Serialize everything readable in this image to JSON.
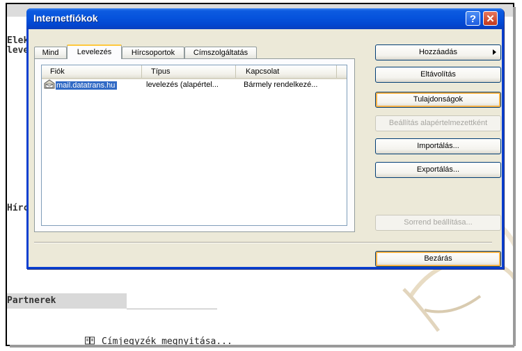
{
  "background": {
    "labels": [
      "Elek",
      "leve",
      "Hírc"
    ],
    "partners_label": "Partnerek",
    "address_book_link": "Címjegyzék megnyitása..."
  },
  "dialog": {
    "title": "Internetfiókok",
    "help_button": "?",
    "close_button": "✕",
    "tabs": [
      "Mind",
      "Levelezés",
      "Hírcsoportok",
      "Címszolgáltatás"
    ],
    "active_tab": "Levelezés",
    "list": {
      "columns": [
        "Fiók",
        "Típus",
        "Kapcsolat"
      ],
      "rows": [
        {
          "account": "mail.datatrans.hu",
          "type": "levelezés (alapértel...",
          "connection": "Bármely rendelkezé..."
        }
      ]
    },
    "buttons": {
      "add": "Hozzáadás",
      "remove": "Eltávolítás",
      "properties": "Tulajdonságok",
      "set_default": "Beállítás alapértelmezettként",
      "import": "Importálás...",
      "export": "Exportálás...",
      "set_order": "Sorrend beállítása...",
      "close": "Bezárás"
    }
  },
  "colors": {
    "titlebar": "#0653dc",
    "dialog_face": "#ece9d8",
    "selection": "#316ac5"
  }
}
